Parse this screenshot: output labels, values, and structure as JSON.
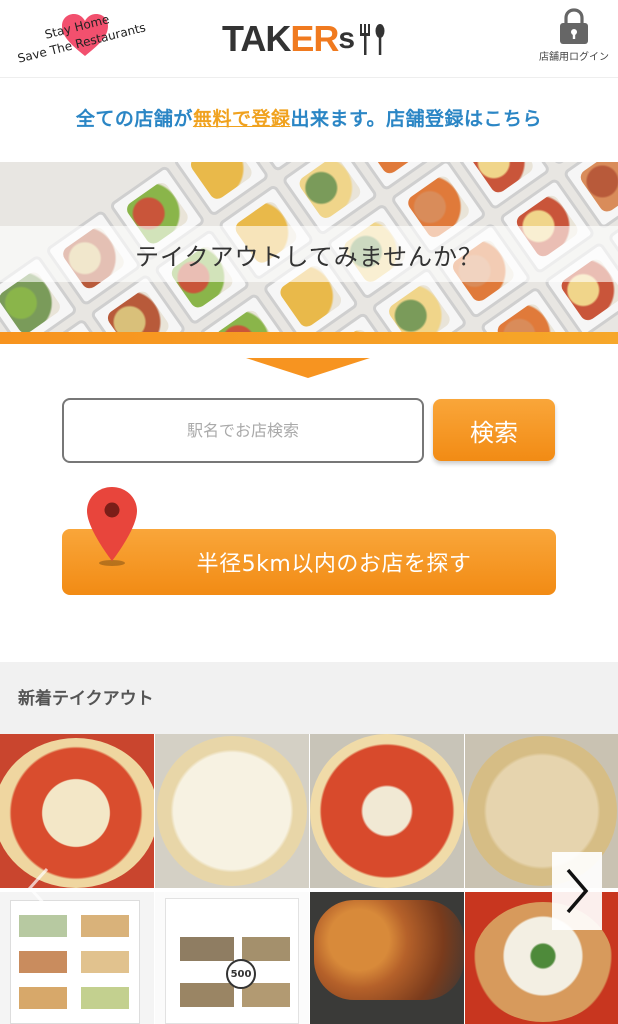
{
  "header": {
    "badge_line1": "Stay Home",
    "badge_line2": "Save The Restaurants",
    "brand_part1": "TAK",
    "brand_part2": "ER",
    "brand_part3": "s",
    "login_label": "店舗用ログイン",
    "login_icon": "lock-icon"
  },
  "registration": {
    "pre": "全ての店舗が",
    "highlight": "無料で登録",
    "post": "出来ます。店舗登録はこちら"
  },
  "hero": {
    "caption": "テイクアウトしてみませんか？"
  },
  "search": {
    "placeholder": "駅名でお店検索",
    "button_label": "検索"
  },
  "nearby": {
    "button_label": "半径5km以内のお店を探す",
    "icon": "map-pin-icon"
  },
  "new_section": {
    "title": "新着テイクアウト"
  },
  "gallery": {
    "prev_icon": "chevron-left-icon",
    "next_icon": "chevron-right-icon",
    "menu_badge": "500"
  },
  "colors": {
    "accent": "#f79420",
    "link_blue": "#2b86c5",
    "highlight": "#f0a21f"
  }
}
